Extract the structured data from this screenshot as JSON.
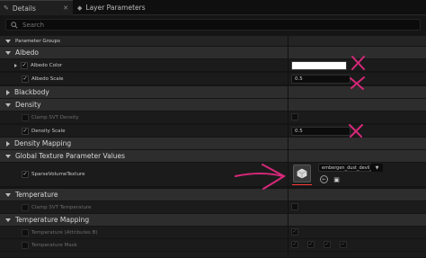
{
  "tabs": [
    {
      "label": "Details",
      "icon": "details-icon",
      "active": true
    },
    {
      "label": "Layer Parameters",
      "icon": "layers-icon",
      "active": false
    }
  ],
  "search": {
    "placeholder": "Search"
  },
  "parameter_groups_label": "Parameter Groups",
  "sections": {
    "albedo": "Albedo",
    "blackbody": "Blackbody",
    "density": "Density",
    "density_mapping": "Density Mapping",
    "global_texture": "Global Texture Parameter Values",
    "temperature": "Temperature",
    "temperature_mapping": "Temperature Mapping"
  },
  "properties": {
    "albedo_color": {
      "label": "Albedo Color",
      "color": "#ffffff",
      "checked": true
    },
    "albedo_scale": {
      "label": "Albedo Scale",
      "value": "0.5",
      "checked": true
    },
    "clamp_svt_density": {
      "label": "Clamp SVT Density",
      "checked": false
    },
    "density_scale": {
      "label": "Density Scale",
      "value": "0.5",
      "checked": true
    },
    "sparse_volume_texture": {
      "label": "SparseVolumeTexture",
      "asset": "embergen_dust_devil_tornado_a",
      "checked": true
    },
    "clamp_svt_temperature": {
      "label": "Clamp SVT Temperature",
      "checked": false
    },
    "temperature_attrib": {
      "label": "Temperature (Attributes B)",
      "checked": false
    },
    "temperature_mask": {
      "label": "Temperature Mask",
      "checked": false
    }
  },
  "colors": {
    "annotation": "#d6287a",
    "underline": "#ff3a3a"
  }
}
